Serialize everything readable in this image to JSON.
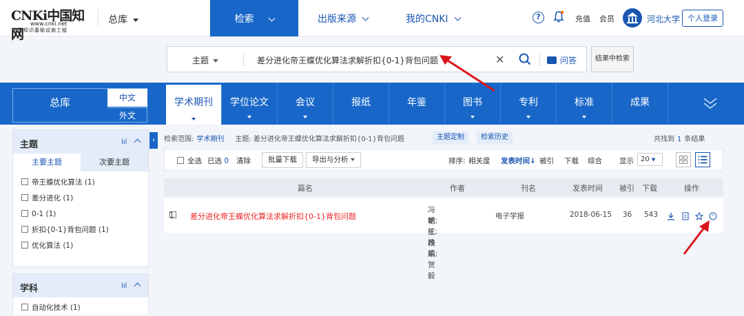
{
  "header": {
    "logo_text": "CNKi中国知网",
    "logo_url": "www.cnki.net",
    "logo_sub": "中国知识基础设施工程",
    "db_select": "总库",
    "nav": [
      {
        "label": "检索"
      },
      {
        "label": "出版来源"
      },
      {
        "label": "我的CNKI"
      }
    ],
    "help_icon": "question-circle-icon",
    "bell_icon": "bell-icon",
    "recharge": "充值",
    "member": "会员",
    "org_name": "河北大学",
    "login": "个人登录"
  },
  "search": {
    "field": "主题",
    "query": "差分进化帝王蝶优化算法求解折扣{0-1}背包问题",
    "qa": "问答",
    "refine": "结果中检索"
  },
  "db_tabs": {
    "zongku": "总库",
    "zh": "中文",
    "wai": "外文",
    "tabs": [
      "学术期刊",
      "学位论文",
      "会议",
      "报纸",
      "年鉴",
      "图书",
      "专利",
      "标准",
      "成果"
    ]
  },
  "facets": [
    {
      "title": "主题",
      "subtabs": [
        "主要主题",
        "次要主题"
      ],
      "items": [
        "帝王蝶优化算法 (1)",
        "差分进化 (1)",
        "0-1 (1)",
        "折扣{0-1}背包问题 (1)",
        "优化算法 (1)"
      ]
    },
    {
      "title": "学科",
      "items": [
        "自动化技术 (1)"
      ]
    }
  ],
  "scope": {
    "label": "检索范围:",
    "value": "学术期刊",
    "topic": "主题: 差分进化帝王蝶优化算法求解折扣{0-1}背包问题",
    "custom": "主题定制",
    "history": "检索历史",
    "found_pre": "共找到",
    "count": "1",
    "found_post": "条结果"
  },
  "toolbar": {
    "select_all": "全选",
    "selected": "已选",
    "selected_count": "0",
    "clear": "清除",
    "batch_download": "批量下载",
    "export": "导出与分析",
    "sort_label": "排序:",
    "sort_relevance": "相关度",
    "sort_date": "发表时间",
    "sort_cited": "被引",
    "sort_download": "下载",
    "sort_composite": "综合",
    "display_label": "显示",
    "display_value": "20"
  },
  "table": {
    "headers": [
      "篇名",
      "作者",
      "刊名",
      "发表时间",
      "被引",
      "下载",
      "操作"
    ],
    "rows": [
      {
        "index": "1",
        "title": "差分进化帝王蝶优化算法求解折扣{0-1}背包问题",
        "authors_line1": "冯艳红;杨娟;贺毅",
        "authors_line2": "朝;王改革",
        "journal": "电子学报",
        "date": "2018-06-15",
        "cited": "36",
        "downloads": "543"
      }
    ]
  },
  "colors": {
    "primary": "#1867c8",
    "link": "#1a56b2",
    "title_red": "#e22222",
    "annotation_red": "#d9161c"
  }
}
